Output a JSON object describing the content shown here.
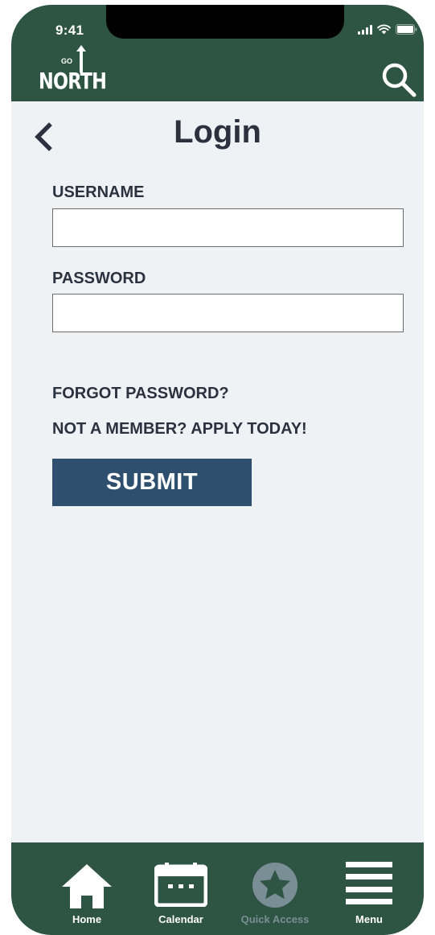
{
  "status_bar": {
    "time": "9:41"
  },
  "header": {
    "logo": {
      "small_text": "GO",
      "word": "NORTH"
    },
    "search_icon": "search-icon"
  },
  "page": {
    "title": "Login",
    "back_icon": "chevron-left-icon"
  },
  "form": {
    "username_label": "USERNAME",
    "username_value": "",
    "password_label": "PASSWORD",
    "password_value": "",
    "forgot_password_link": "FORGOT PASSWORD?",
    "apply_link": "NOT A MEMBER? APPLY TODAY!",
    "submit_label": "SUBMIT"
  },
  "bottom_nav": {
    "items": [
      {
        "label": "Home",
        "icon": "home-icon",
        "enabled": true
      },
      {
        "label": "Calendar",
        "icon": "calendar-icon",
        "enabled": true
      },
      {
        "label": "Quick Access",
        "icon": "star-icon",
        "enabled": false
      },
      {
        "label": "Menu",
        "icon": "menu-icon",
        "enabled": true
      }
    ]
  },
  "colors": {
    "header_green": "#2e5443",
    "background": "#eff2f5",
    "submit_blue": "#2e4f6e",
    "text_dark": "#2c3140",
    "disabled_gray": "#7a8f95"
  }
}
